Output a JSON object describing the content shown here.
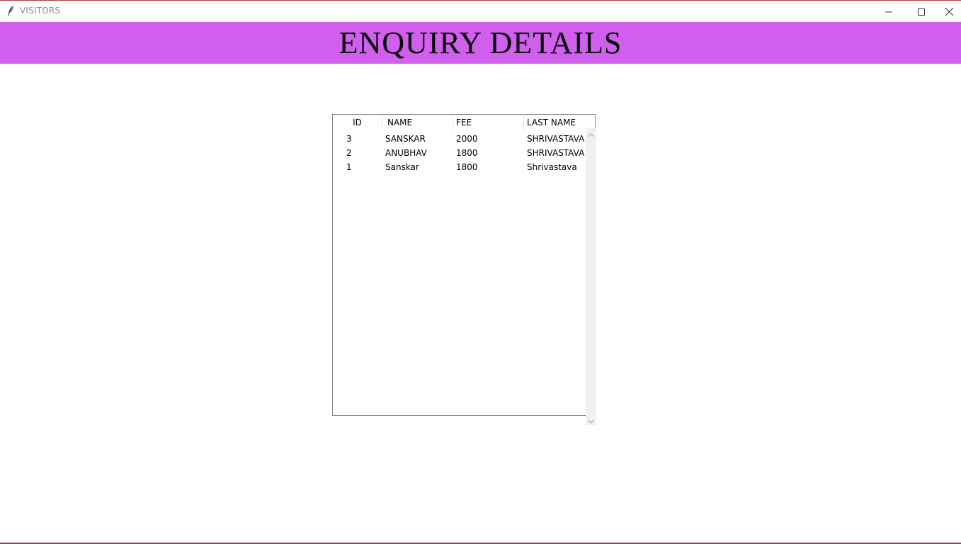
{
  "window": {
    "title": "VISITORS"
  },
  "banner": {
    "title": "ENQUIRY DETAILS",
    "color": "#d15fee"
  },
  "table": {
    "columns": [
      "ID",
      "NAME",
      "FEE",
      "LAST NAME"
    ],
    "rows": [
      {
        "id": "3",
        "name": "SANSKAR",
        "fee": "2000",
        "last_name": "SHRIVASTAVA"
      },
      {
        "id": "2",
        "name": "ANUBHAV",
        "fee": "1800",
        "last_name": "SHRIVASTAVA"
      },
      {
        "id": "1",
        "name": "Sanskar",
        "fee": "1800",
        "last_name": "Shrivastava"
      }
    ]
  },
  "icons": {
    "app": "feather-icon",
    "minimize": "minimize-icon",
    "maximize": "maximize-icon",
    "close": "close-icon",
    "scroll_up": "chevron-up-icon",
    "scroll_down": "chevron-down-icon"
  }
}
